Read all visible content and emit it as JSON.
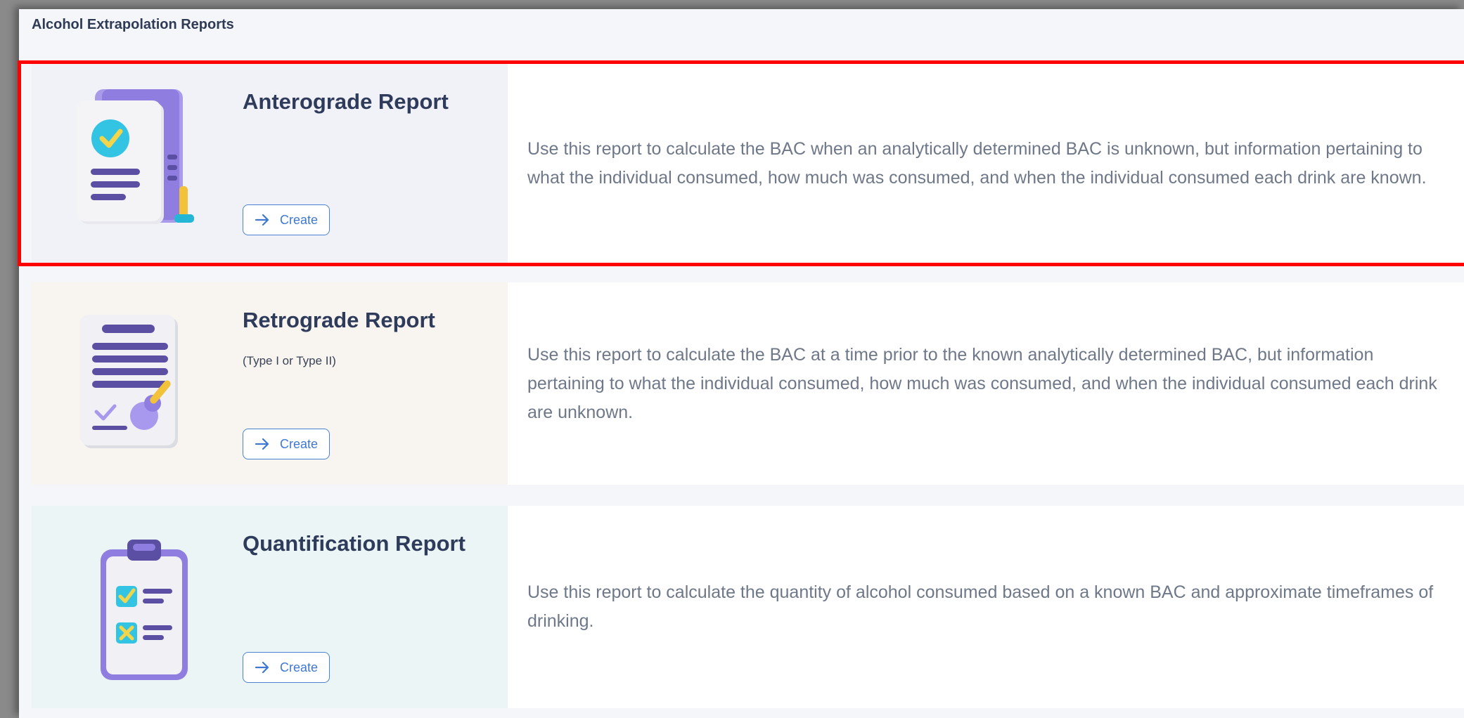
{
  "header": {
    "title": "Alcohol Extrapolation Reports"
  },
  "reports": [
    {
      "title": "Anterograde Report",
      "subtitle": "",
      "button_label": "Create",
      "description": "Use this report to calculate the BAC when an analytically determined BAC is unknown, but information pertaining to what the individual consumed, how much was consumed, and when the individual consumed each drink are known.",
      "icon": "document-check-icon",
      "bg_color": "#f1f2f8"
    },
    {
      "title": "Retrograde Report",
      "subtitle": "(Type I or Type II)",
      "button_label": "Create",
      "description": "Use this report to calculate the BAC at a time prior to the known analytically determined BAC, but information pertaining to what the individual consumed, how much was consumed, and when the individual consumed each drink are unknown.",
      "icon": "document-stamp-icon",
      "bg_color": "#f8f4ef"
    },
    {
      "title": "Quantification Report",
      "subtitle": "",
      "button_label": "Create",
      "description": "Use this report to calculate the quantity of alcohol consumed based on a known BAC and approximate timeframes of drinking.",
      "icon": "clipboard-checklist-icon",
      "bg_color": "#ebf5f5"
    }
  ],
  "colors": {
    "accent": "#4a83d4",
    "highlight": "#ff0000",
    "title": "#2e3b5b",
    "description": "#6e7889"
  }
}
